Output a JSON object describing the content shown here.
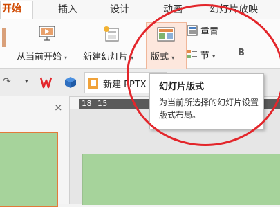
{
  "tabs": [
    {
      "label": "开始",
      "active": true
    },
    {
      "label": "插入",
      "active": false
    },
    {
      "label": "设计",
      "active": false
    },
    {
      "label": "动画",
      "active": false
    },
    {
      "label": "幻灯片放映",
      "active": false
    }
  ],
  "ribbon": {
    "from_current": "从当前开始",
    "new_slide": "新建幻灯片",
    "layout": "版式",
    "reset": "重置",
    "section": "节",
    "bold": "B"
  },
  "quick_access": {
    "doc_tab": "新建 PPTX"
  },
  "ruler": {
    "marks": "18 15"
  },
  "panel": {
    "close_glyph": "×"
  },
  "tooltip": {
    "title": "幻灯片版式",
    "description": "为当前所选择的幻灯片设置版式布局。"
  },
  "colors": {
    "accent": "#d04a02",
    "slide_green": "#a6d39b",
    "annotation_red": "#e3262b",
    "layout_highlight": "#fde7dd"
  }
}
